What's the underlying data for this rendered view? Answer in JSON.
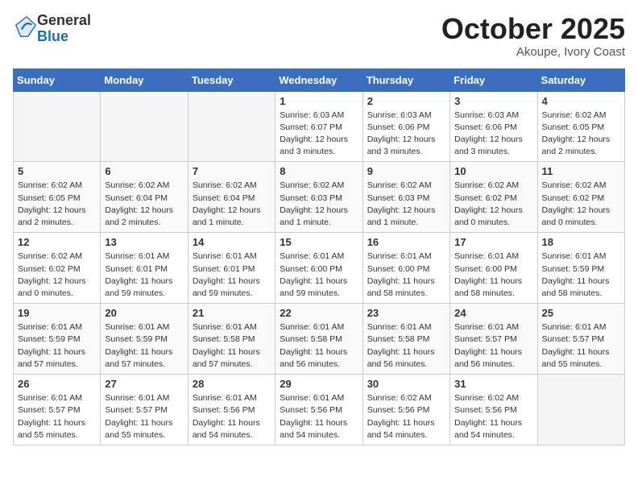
{
  "logo": {
    "general": "General",
    "blue": "Blue"
  },
  "header": {
    "month": "October 2025",
    "location": "Akoupe, Ivory Coast"
  },
  "weekdays": [
    "Sunday",
    "Monday",
    "Tuesday",
    "Wednesday",
    "Thursday",
    "Friday",
    "Saturday"
  ],
  "weeks": [
    [
      {
        "day": "",
        "info": ""
      },
      {
        "day": "",
        "info": ""
      },
      {
        "day": "",
        "info": ""
      },
      {
        "day": "1",
        "info": "Sunrise: 6:03 AM\nSunset: 6:07 PM\nDaylight: 12 hours\nand 3 minutes."
      },
      {
        "day": "2",
        "info": "Sunrise: 6:03 AM\nSunset: 6:06 PM\nDaylight: 12 hours\nand 3 minutes."
      },
      {
        "day": "3",
        "info": "Sunrise: 6:03 AM\nSunset: 6:06 PM\nDaylight: 12 hours\nand 3 minutes."
      },
      {
        "day": "4",
        "info": "Sunrise: 6:02 AM\nSunset: 6:05 PM\nDaylight: 12 hours\nand 2 minutes."
      }
    ],
    [
      {
        "day": "5",
        "info": "Sunrise: 6:02 AM\nSunset: 6:05 PM\nDaylight: 12 hours\nand 2 minutes."
      },
      {
        "day": "6",
        "info": "Sunrise: 6:02 AM\nSunset: 6:04 PM\nDaylight: 12 hours\nand 2 minutes."
      },
      {
        "day": "7",
        "info": "Sunrise: 6:02 AM\nSunset: 6:04 PM\nDaylight: 12 hours\nand 1 minute."
      },
      {
        "day": "8",
        "info": "Sunrise: 6:02 AM\nSunset: 6:03 PM\nDaylight: 12 hours\nand 1 minute."
      },
      {
        "day": "9",
        "info": "Sunrise: 6:02 AM\nSunset: 6:03 PM\nDaylight: 12 hours\nand 1 minute."
      },
      {
        "day": "10",
        "info": "Sunrise: 6:02 AM\nSunset: 6:02 PM\nDaylight: 12 hours\nand 0 minutes."
      },
      {
        "day": "11",
        "info": "Sunrise: 6:02 AM\nSunset: 6:02 PM\nDaylight: 12 hours\nand 0 minutes."
      }
    ],
    [
      {
        "day": "12",
        "info": "Sunrise: 6:02 AM\nSunset: 6:02 PM\nDaylight: 12 hours\nand 0 minutes."
      },
      {
        "day": "13",
        "info": "Sunrise: 6:01 AM\nSunset: 6:01 PM\nDaylight: 11 hours\nand 59 minutes."
      },
      {
        "day": "14",
        "info": "Sunrise: 6:01 AM\nSunset: 6:01 PM\nDaylight: 11 hours\nand 59 minutes."
      },
      {
        "day": "15",
        "info": "Sunrise: 6:01 AM\nSunset: 6:00 PM\nDaylight: 11 hours\nand 59 minutes."
      },
      {
        "day": "16",
        "info": "Sunrise: 6:01 AM\nSunset: 6:00 PM\nDaylight: 11 hours\nand 58 minutes."
      },
      {
        "day": "17",
        "info": "Sunrise: 6:01 AM\nSunset: 6:00 PM\nDaylight: 11 hours\nand 58 minutes."
      },
      {
        "day": "18",
        "info": "Sunrise: 6:01 AM\nSunset: 5:59 PM\nDaylight: 11 hours\nand 58 minutes."
      }
    ],
    [
      {
        "day": "19",
        "info": "Sunrise: 6:01 AM\nSunset: 5:59 PM\nDaylight: 11 hours\nand 57 minutes."
      },
      {
        "day": "20",
        "info": "Sunrise: 6:01 AM\nSunset: 5:59 PM\nDaylight: 11 hours\nand 57 minutes."
      },
      {
        "day": "21",
        "info": "Sunrise: 6:01 AM\nSunset: 5:58 PM\nDaylight: 11 hours\nand 57 minutes."
      },
      {
        "day": "22",
        "info": "Sunrise: 6:01 AM\nSunset: 5:58 PM\nDaylight: 11 hours\nand 56 minutes."
      },
      {
        "day": "23",
        "info": "Sunrise: 6:01 AM\nSunset: 5:58 PM\nDaylight: 11 hours\nand 56 minutes."
      },
      {
        "day": "24",
        "info": "Sunrise: 6:01 AM\nSunset: 5:57 PM\nDaylight: 11 hours\nand 56 minutes."
      },
      {
        "day": "25",
        "info": "Sunrise: 6:01 AM\nSunset: 5:57 PM\nDaylight: 11 hours\nand 55 minutes."
      }
    ],
    [
      {
        "day": "26",
        "info": "Sunrise: 6:01 AM\nSunset: 5:57 PM\nDaylight: 11 hours\nand 55 minutes."
      },
      {
        "day": "27",
        "info": "Sunrise: 6:01 AM\nSunset: 5:57 PM\nDaylight: 11 hours\nand 55 minutes."
      },
      {
        "day": "28",
        "info": "Sunrise: 6:01 AM\nSunset: 5:56 PM\nDaylight: 11 hours\nand 54 minutes."
      },
      {
        "day": "29",
        "info": "Sunrise: 6:01 AM\nSunset: 5:56 PM\nDaylight: 11 hours\nand 54 minutes."
      },
      {
        "day": "30",
        "info": "Sunrise: 6:02 AM\nSunset: 5:56 PM\nDaylight: 11 hours\nand 54 minutes."
      },
      {
        "day": "31",
        "info": "Sunrise: 6:02 AM\nSunset: 5:56 PM\nDaylight: 11 hours\nand 54 minutes."
      },
      {
        "day": "",
        "info": ""
      }
    ]
  ]
}
